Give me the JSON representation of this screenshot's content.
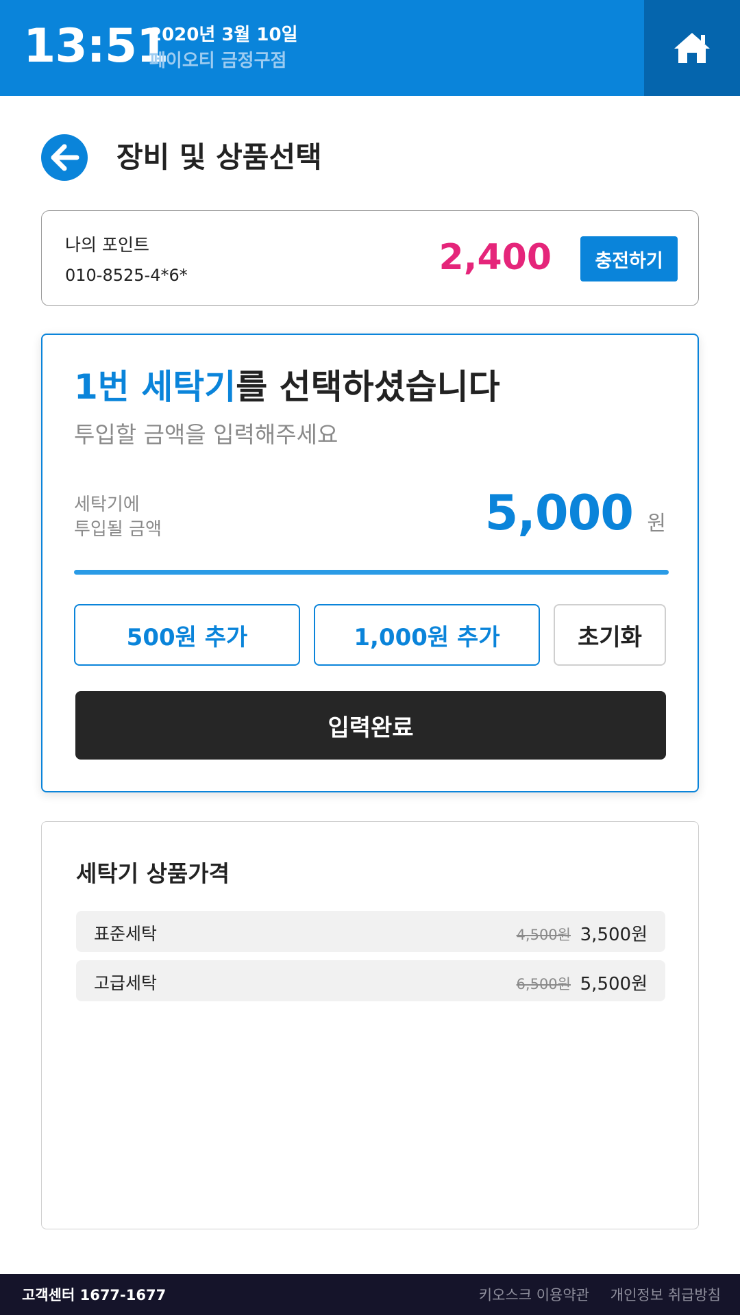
{
  "header": {
    "time": "13:51",
    "date": "2020년 3월 10일",
    "store": "페이오티 금정구점",
    "home_icon": "home-icon"
  },
  "page": {
    "title": "장비 및 상품선택",
    "back_icon": "arrow-left-icon"
  },
  "points": {
    "label": "나의 포인트",
    "phone": "010-8525-4*6*",
    "value": "2,400",
    "charge_label": "충전하기"
  },
  "selection": {
    "machine": "1번 세탁기",
    "headline_suffix": "를 선택하셨습니다",
    "subtitle": "투입할 금액을 입력해주세요",
    "amount_label_line1": "세탁기에",
    "amount_label_line2": "투입될 금액",
    "amount": "5,000",
    "amount_unit": "원",
    "add_500_label": "500원 추가",
    "add_1000_label": "1,000원 추가",
    "reset_label": "초기화",
    "confirm_label": "입력완료"
  },
  "prices": {
    "title": "세탁기 상품가격",
    "items": [
      {
        "name": "표준세탁",
        "old_price": "4,500원",
        "price": "3,500원"
      },
      {
        "name": "고급세탁",
        "old_price": "6,500원",
        "price": "5,500원"
      }
    ]
  },
  "footer": {
    "customer_center": "고객센터 1677-1677",
    "terms": "키오스크 이용약관",
    "privacy": "개인정보 취급방침"
  },
  "colors": {
    "primary": "#0a84da",
    "primary_dark": "#0565ad",
    "points": "#e5257a",
    "confirm": "#262626",
    "footer": "#15142a"
  }
}
